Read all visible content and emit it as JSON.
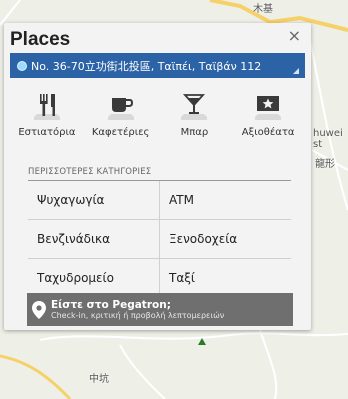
{
  "map": {
    "labels": {
      "top": "木基",
      "right_top": "huwei st",
      "right_mid": "龍形",
      "bottom": "中坑"
    }
  },
  "panel": {
    "title": "Places",
    "close_label": "×",
    "location": "No. 36-70立功街北投區, Ταϊπέι, Ταϊβάν 112"
  },
  "categories": [
    {
      "label": "Εστιατόρια",
      "icon": "restaurant-icon"
    },
    {
      "label": "Καφετέριες",
      "icon": "cafe-icon"
    },
    {
      "label": "Μπαρ",
      "icon": "bar-icon"
    },
    {
      "label": "Αξιοθέατα",
      "icon": "attractions-icon"
    }
  ],
  "more": {
    "title": "ΠΕΡΙΣΣΟΤΕΡΕΣ ΚΑΤΗΓΟΡΙΕΣ",
    "rows": [
      [
        "Ψυχαγωγία",
        "ATM"
      ],
      [
        "Βενζινάδικα",
        "Ξενοδοχεία"
      ],
      [
        "Ταχυδρομείο",
        "Ταξί"
      ]
    ]
  },
  "checkin": {
    "title": "Είστε στο Pegatron;",
    "subtitle": "Check-in, κριτική ή προβολή λεπτομερειών"
  },
  "colors": {
    "location_bar": "#2c62a6",
    "checkin_bar": "#6f6f6f",
    "panel_bg": "#f3f3f3"
  }
}
